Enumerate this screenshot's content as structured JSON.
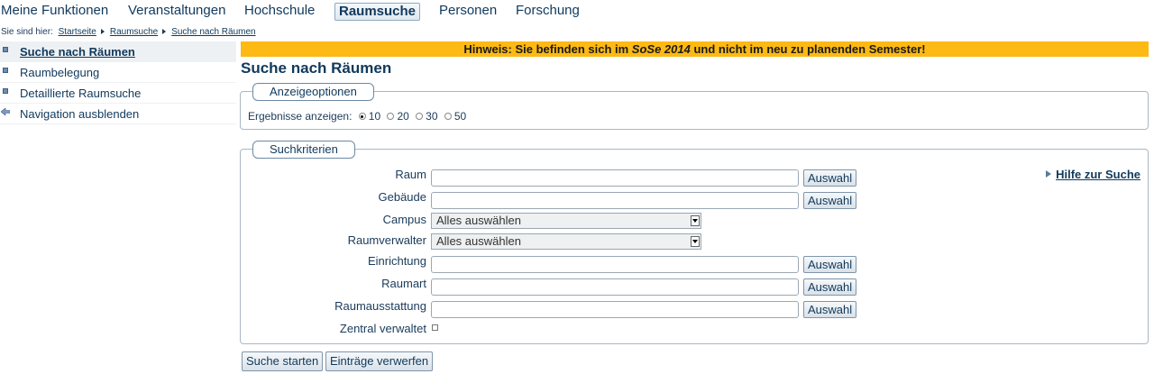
{
  "topnav": {
    "items": [
      {
        "label": "Meine Funktionen"
      },
      {
        "label": "Veranstaltungen"
      },
      {
        "label": "Hochschule"
      },
      {
        "label": "Raumsuche"
      },
      {
        "label": "Personen"
      },
      {
        "label": "Forschung"
      }
    ],
    "active": "Raumsuche"
  },
  "breadcrumb": {
    "prefix": "Sie sind hier:",
    "items": [
      {
        "label": "Startseite"
      },
      {
        "label": "Raumsuche"
      },
      {
        "label": "Suche nach Räumen"
      }
    ]
  },
  "sidebar": {
    "items": [
      {
        "label": "Suche nach Räumen",
        "active": true,
        "icon": "bullet-icon"
      },
      {
        "label": "Raumbelegung",
        "icon": "bullet-icon"
      },
      {
        "label": "Detaillierte Raumsuche",
        "icon": "bullet-icon"
      },
      {
        "label": "Navigation ausblenden",
        "icon": "arrow-left-icon"
      }
    ]
  },
  "notice": {
    "pre": "Hinweis: Sie befinden sich im ",
    "semester": "SoSe 2014",
    "post": " und nicht im neu zu planenden Semester!"
  },
  "page_title": "Suche nach Räumen",
  "display_options": {
    "legend": "Anzeigeoptionen",
    "label": "Ergebnisse anzeigen:",
    "options": [
      "10",
      "20",
      "30",
      "50"
    ],
    "selected": "10"
  },
  "search_criteria": {
    "legend": "Suchkriterien",
    "help_link": "Hilfe zur Suche",
    "fields": [
      {
        "label": "Raum",
        "type": "text",
        "value": "",
        "button": "Auswahl"
      },
      {
        "label": "Gebäude",
        "type": "text",
        "value": "",
        "button": "Auswahl"
      },
      {
        "label": "Campus",
        "type": "select",
        "value": "Alles auswählen"
      },
      {
        "label": "Raumverwalter",
        "type": "select",
        "value": "Alles auswählen"
      },
      {
        "label": "Einrichtung",
        "type": "text",
        "value": "",
        "button": "Auswahl"
      },
      {
        "label": "Raumart",
        "type": "text",
        "value": "",
        "button": "Auswahl"
      },
      {
        "label": "Raumausstattung",
        "type": "text",
        "value": "",
        "button": "Auswahl"
      },
      {
        "label": "Zentral verwaltet",
        "type": "checkbox",
        "checked": false
      }
    ]
  },
  "actions": {
    "search": "Suche starten",
    "reset": "Einträge verwerfen"
  },
  "colors": {
    "notice_bg": "#fdb914",
    "link": "#10395c",
    "border": "#a9b7c4"
  }
}
